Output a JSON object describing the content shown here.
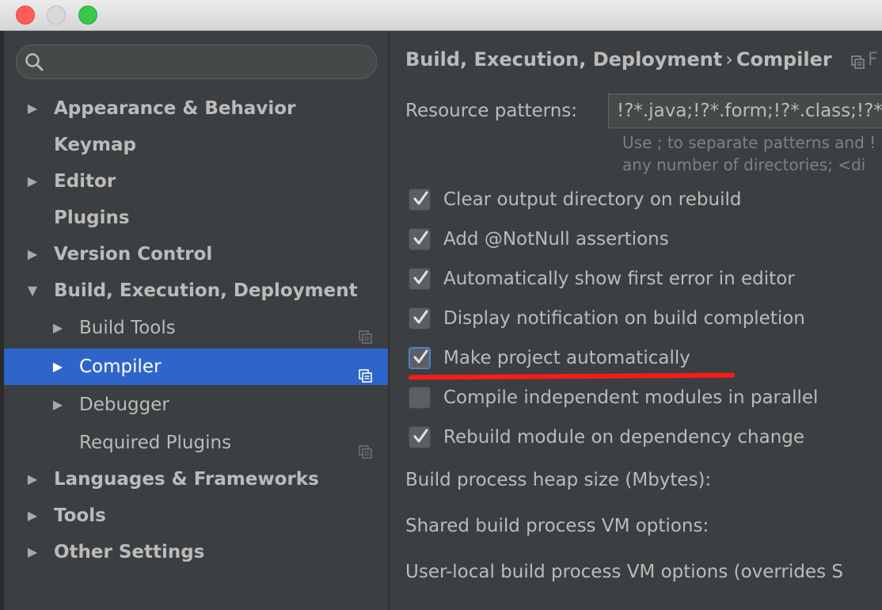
{
  "window": {
    "controls": [
      "close",
      "minimize",
      "zoom"
    ]
  },
  "search": {
    "value": ""
  },
  "sidebar": {
    "items": [
      {
        "label": "Appearance & Behavior",
        "arrow": "▶"
      },
      {
        "label": "Keymap",
        "arrow": ""
      },
      {
        "label": "Editor",
        "arrow": "▶"
      },
      {
        "label": "Plugins",
        "arrow": ""
      },
      {
        "label": "Version Control",
        "arrow": "▶"
      },
      {
        "label": "Build, Execution, Deployment",
        "arrow": "▼"
      },
      {
        "label": "Build Tools",
        "arrow": "▶"
      },
      {
        "label": "Compiler",
        "arrow": "▶"
      },
      {
        "label": "Debugger",
        "arrow": "▶"
      },
      {
        "label": "Required Plugins",
        "arrow": ""
      },
      {
        "label": "Languages & Frameworks",
        "arrow": "▶"
      },
      {
        "label": "Tools",
        "arrow": "▶"
      },
      {
        "label": "Other Settings",
        "arrow": "▶"
      }
    ],
    "selected": "Compiler"
  },
  "main": {
    "breadcrumb": {
      "parent": "Build, Execution, Deployment",
      "separator": "›",
      "current": "Compiler",
      "trailing": "F"
    },
    "resource_patterns": {
      "label": "Resource patterns:",
      "value": "!?*.java;!?*.form;!?*.class;!?*",
      "hint_line1": "Use ; to separate patterns and !",
      "hint_line2": "any number of directories; <di"
    },
    "options": [
      {
        "label": "Clear output directory on rebuild",
        "checked": true
      },
      {
        "label": "Add @NotNull assertions",
        "checked": true
      },
      {
        "label": "Automatically show first error in editor",
        "checked": true
      },
      {
        "label": "Display notification on build completion",
        "checked": true
      },
      {
        "label": "Make project automatically",
        "checked": true
      },
      {
        "label": "Compile independent modules in parallel",
        "checked": false
      },
      {
        "label": "Rebuild module on dependency change",
        "checked": true
      }
    ],
    "heap_label": "Build process heap size (Mbytes):",
    "shared_vm_label": "Shared build process VM options:",
    "user_vm_label": "User-local build process VM options (overrides S"
  },
  "colors": {
    "selection": "#2f65ca",
    "annotation": "#ff1a1a",
    "background": "#3c3f41"
  }
}
